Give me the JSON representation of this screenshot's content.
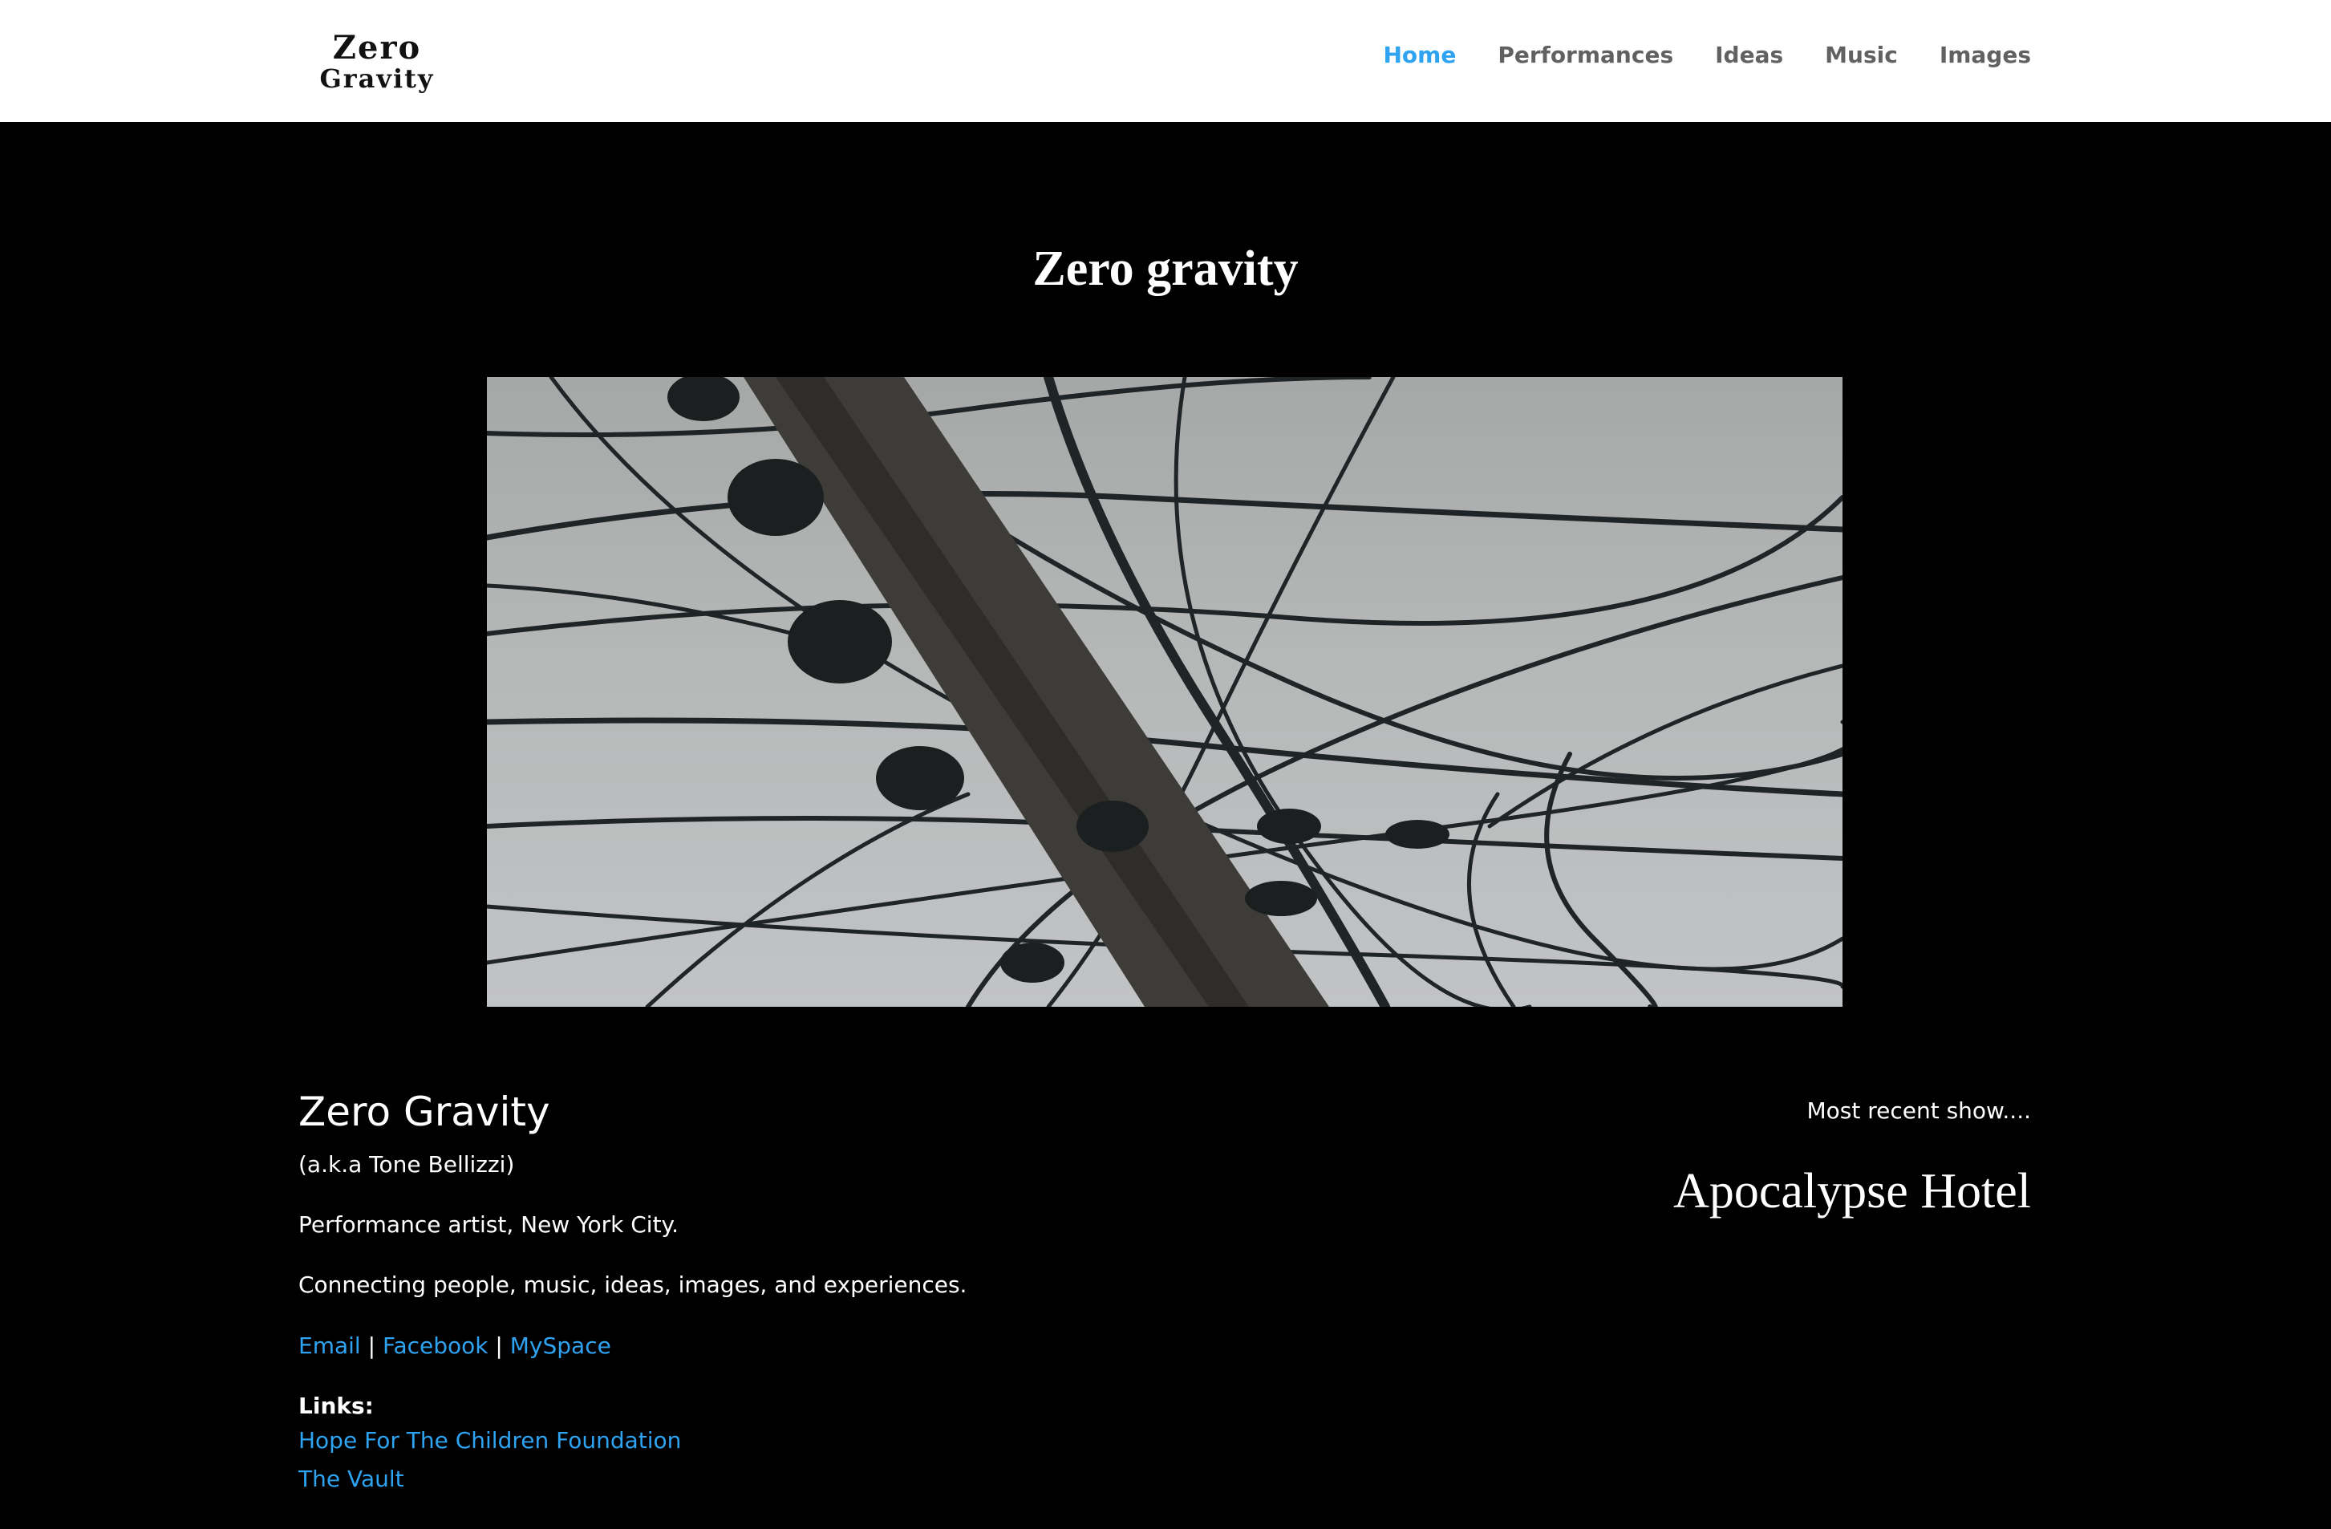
{
  "header": {
    "logo_line1": "Zero",
    "logo_line2": "Gravity",
    "nav": [
      {
        "label": "Home",
        "active": true
      },
      {
        "label": "Performances",
        "active": false
      },
      {
        "label": "Ideas",
        "active": false
      },
      {
        "label": "Music",
        "active": false
      },
      {
        "label": "Images",
        "active": false
      }
    ]
  },
  "hero": {
    "title": "Zero gravity"
  },
  "about": {
    "name": "Zero Gravity",
    "aka": "(a.k.a Tone Bellizzi)",
    "description": "Performance artist, New York City.",
    "tagline": "Connecting people, music, ideas, images, and experiences.",
    "contact_links": [
      "Email",
      "Facebook",
      "MySpace"
    ],
    "separator": "|",
    "links_label": "Links:",
    "links": [
      "Hope For The Children Foundation",
      "The Vault"
    ]
  },
  "recent": {
    "label": "Most recent show....",
    "show_title": "Apocalypse Hotel"
  },
  "colors": {
    "accent": "#2ea3f2",
    "background": "#000000",
    "header_bg": "#ffffff"
  }
}
